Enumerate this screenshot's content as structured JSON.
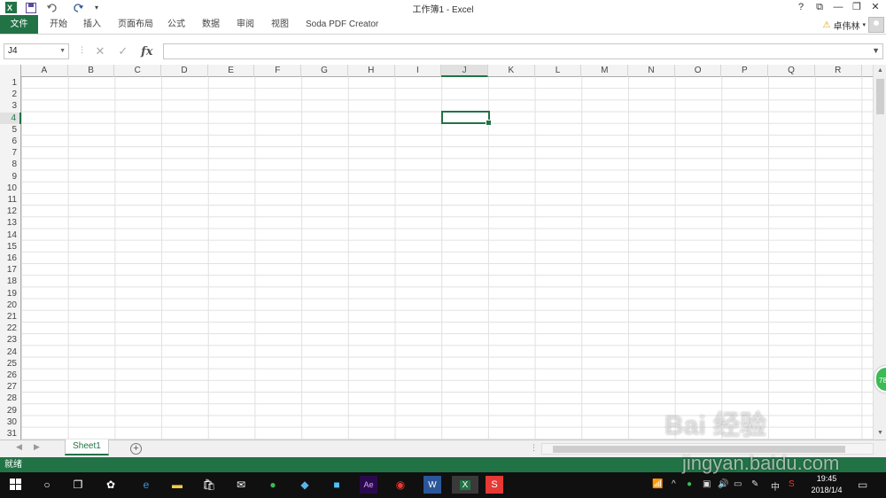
{
  "window": {
    "title": "工作簿1 - Excel",
    "controls": {
      "help": "?",
      "ribbon_display": "⧉",
      "minimize": "—",
      "restore": "❐",
      "close": "✕"
    }
  },
  "quick_access": {
    "save": "save-icon",
    "undo": "undo-icon",
    "redo": "redo-icon",
    "customize": "▾"
  },
  "ribbon": {
    "tabs": [
      {
        "label": "文件"
      },
      {
        "label": "开始"
      },
      {
        "label": "插入"
      },
      {
        "label": "页面布局"
      },
      {
        "label": "公式"
      },
      {
        "label": "数据"
      },
      {
        "label": "审阅"
      },
      {
        "label": "视图"
      },
      {
        "label": "Soda PDF Creator"
      }
    ],
    "user_name": "卓伟林"
  },
  "formula_bar": {
    "name_box": "J4",
    "fx": "fx",
    "content": ""
  },
  "grid": {
    "columns": [
      "A",
      "B",
      "C",
      "D",
      "E",
      "F",
      "G",
      "H",
      "I",
      "J",
      "K",
      "L",
      "M",
      "N",
      "O",
      "P",
      "Q",
      "R"
    ],
    "rows": [
      "1",
      "2",
      "3",
      "4",
      "5",
      "6",
      "7",
      "8",
      "9",
      "10",
      "11",
      "12",
      "13",
      "14",
      "15",
      "16",
      "17",
      "18",
      "19",
      "20",
      "21",
      "22",
      "23",
      "24",
      "25",
      "26",
      "27",
      "28",
      "29",
      "30",
      "31"
    ],
    "active_cell": "J4",
    "side_badge": "78"
  },
  "sheets": {
    "tabs": [
      {
        "label": "Sheet1"
      }
    ],
    "add": "+"
  },
  "status": {
    "ready": "就绪"
  },
  "taskbar": {
    "ime": "中",
    "time": "19:45",
    "date": "2018/1/4"
  },
  "watermark": {
    "line1": "Bai 经验",
    "line2": "jingyan.baidu.com"
  },
  "colors": {
    "excel_green": "#217346",
    "taskbar": "#101010"
  }
}
